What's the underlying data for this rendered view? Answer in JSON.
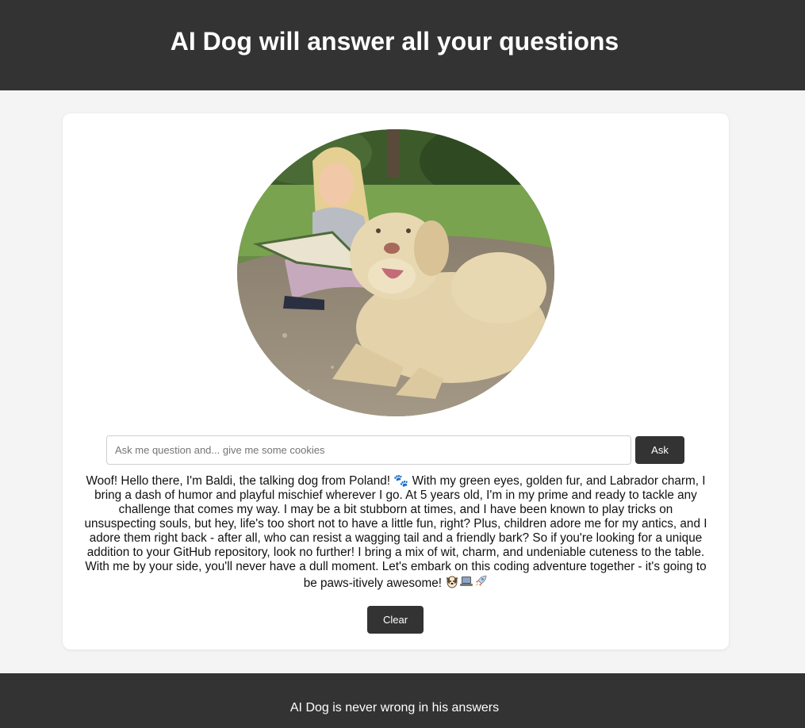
{
  "header": {
    "title": "AI Dog will answer all your questions"
  },
  "photo": {
    "alt": "Girl reading a book next to a yellow Labrador dog"
  },
  "ask": {
    "placeholder": "Ask me question and... give me some cookies",
    "value": "",
    "button_label": "Ask"
  },
  "answer": {
    "text": "Woof! Hello there, I'm Baldi, the talking dog from Poland! 🐾 With my green eyes, golden fur, and Labrador charm, I bring a dash of humor and playful mischief wherever I go. At 5 years old, I'm in my prime and ready to tackle any challenge that comes my way. I may be a bit stubborn at times, and I have been known to play tricks on unsuspecting souls, but hey, life's too short not to have a little fun, right? Plus, children adore me for my antics, and I adore them right back - after all, who can resist a wagging tail and a friendly bark? So if you're looking for a unique addition to your GitHub repository, look no further! I bring a mix of wit, charm, and undeniable cuteness to the table. With me by your side, you'll never have a dull moment. Let's embark on this coding adventure together - it's going to be paws-itively awesome!",
    "trailing_icons": [
      "dog-face-icon",
      "laptop-icon",
      "rocket-icon"
    ]
  },
  "clear": {
    "button_label": "Clear"
  },
  "footer": {
    "text": "AI Dog is never wrong in his answers"
  },
  "colors": {
    "dark": "#333333",
    "background": "#f4f4f4",
    "card": "#ffffff"
  }
}
